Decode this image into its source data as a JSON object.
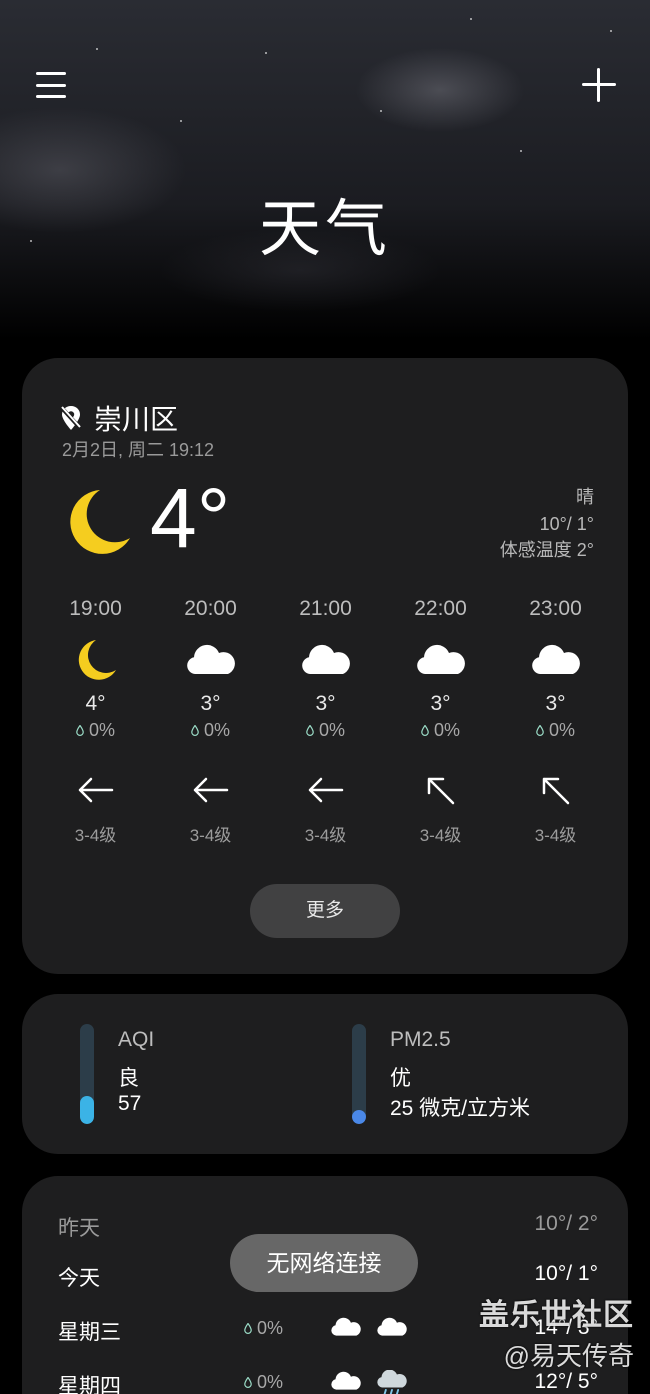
{
  "header": {
    "title": "天气",
    "menu_icon": "hamburger-menu-icon",
    "add_icon": "plus-icon"
  },
  "location": {
    "name": "崇川区",
    "datetime": "2月2日, 周二 19:12",
    "icon": "location-off-icon"
  },
  "current": {
    "temp": "4°",
    "condition": "晴",
    "range": "10°/ 1°",
    "feels_like": "体感温度 2°",
    "icon": "moon-icon"
  },
  "hourly": [
    {
      "time": "19:00",
      "icon": "moon-icon",
      "temp": "4°",
      "rain": "0%",
      "wind_dir": "east",
      "wind": "3-4级"
    },
    {
      "time": "20:00",
      "icon": "cloud-icon",
      "temp": "3°",
      "rain": "0%",
      "wind_dir": "east",
      "wind": "3-4级"
    },
    {
      "time": "21:00",
      "icon": "cloud-icon",
      "temp": "3°",
      "rain": "0%",
      "wind_dir": "east",
      "wind": "3-4级"
    },
    {
      "time": "22:00",
      "icon": "cloud-icon",
      "temp": "3°",
      "rain": "0%",
      "wind_dir": "southeast",
      "wind": "3-4级"
    },
    {
      "time": "23:00",
      "icon": "cloud-icon",
      "temp": "3°",
      "rain": "0%",
      "wind_dir": "southeast",
      "wind": "3-4级"
    }
  ],
  "more_label": "更多",
  "air": {
    "aqi": {
      "name": "AQI",
      "level": "良",
      "value": "57",
      "fill": 0.28,
      "color": "#3bb3e6"
    },
    "pm25": {
      "name": "PM2.5",
      "level": "优",
      "value": "25 微克/立方米",
      "fill": 0.12,
      "color": "#4a88e8"
    }
  },
  "daily": [
    {
      "name": "昨天",
      "rain": "",
      "range": "10°/ 2°",
      "icons": []
    },
    {
      "name": "今天",
      "rain": "",
      "range": "10°/ 1°",
      "icons": []
    },
    {
      "name": "星期三",
      "rain": "0%",
      "range": "14°/ 3°",
      "icons": [
        "cloud-icon",
        "cloud-icon"
      ]
    },
    {
      "name": "星期四",
      "rain": "0%",
      "range": "12°/ 5°",
      "icons": [
        "cloud-icon",
        "rain-cloud-icon"
      ]
    }
  ],
  "toast": "无网络连接",
  "watermark": {
    "title": "盖乐世社区",
    "sub": "@易天传奇"
  }
}
